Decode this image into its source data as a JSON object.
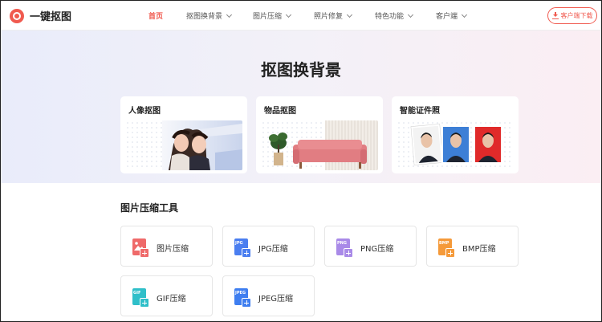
{
  "header": {
    "brand": "一键抠图",
    "nav": [
      {
        "label": "首页",
        "active": true,
        "dropdown": false
      },
      {
        "label": "抠图换背景",
        "active": false,
        "dropdown": true
      },
      {
        "label": "图片压缩",
        "active": false,
        "dropdown": true
      },
      {
        "label": "照片修复",
        "active": false,
        "dropdown": true
      },
      {
        "label": "特色功能",
        "active": false,
        "dropdown": true
      },
      {
        "label": "客户端",
        "active": false,
        "dropdown": true
      }
    ],
    "download_button": "客户端下载"
  },
  "hero": {
    "title": "抠图换背景",
    "cards": [
      {
        "title": "人像抠图"
      },
      {
        "title": "物品抠图"
      },
      {
        "title": "智能证件照"
      }
    ]
  },
  "compress": {
    "title": "图片压缩工具",
    "tools": [
      {
        "label": "图片压缩",
        "tag": "",
        "icon": "image-compress-icon",
        "color": "#ef6a6a"
      },
      {
        "label": "JPG压缩",
        "tag": "JPG",
        "icon": "jpg-file-icon",
        "color": "#4a7ef0"
      },
      {
        "label": "PNG压缩",
        "tag": "PNG",
        "icon": "png-file-icon",
        "color": "#a98ae8"
      },
      {
        "label": "BMP压缩",
        "tag": "BMP",
        "icon": "bmp-file-icon",
        "color": "#f59a3a"
      },
      {
        "label": "GIF压缩",
        "tag": "GIF",
        "icon": "gif-file-icon",
        "color": "#2fbfc9"
      },
      {
        "label": "JPEG压缩",
        "tag": "JPEG",
        "icon": "jpeg-file-icon",
        "color": "#3e7ef0"
      }
    ]
  },
  "colors": {
    "accent": "#f05a4f"
  }
}
